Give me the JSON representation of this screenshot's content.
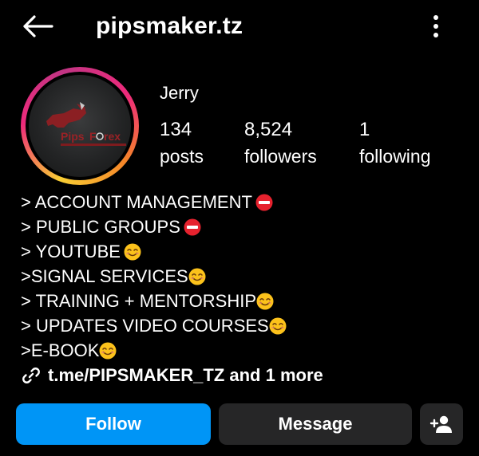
{
  "header": {
    "username": "pipsmaker.tz",
    "back_icon": "arrow-left-icon",
    "more_icon": "vertical-dots-icon"
  },
  "profile": {
    "display_name": "Jerry",
    "avatar": {
      "brand_text_1": "Pips",
      "brand_text_2": "F",
      "brand_text_3": "rex",
      "ring_colors": [
        "#f9ce34",
        "#ee2a7b",
        "#c13584",
        "#f58529"
      ]
    }
  },
  "stats": {
    "posts": {
      "value": "134",
      "label": "posts"
    },
    "followers": {
      "value": "8,524",
      "label": "followers"
    },
    "following": {
      "value": "1",
      "label": "following"
    }
  },
  "bio": {
    "lines": [
      {
        "text": "> ACCOUNT MANAGEMENT ",
        "emoji": "no-entry-emoji"
      },
      {
        "text": "> PUBLIC GROUPS ",
        "emoji": "no-entry-emoji"
      },
      {
        "text": "> YOUTUBE ",
        "emoji": "smiling-face-emoji"
      },
      {
        "text": ">SIGNAL SERVICES",
        "emoji": "smiling-face-emoji"
      },
      {
        "text": "> TRAINING + MENTORSHIP",
        "emoji": "smiling-face-emoji"
      },
      {
        "text": "> UPDATES VIDEO COURSES",
        "emoji": "smiling-face-emoji"
      },
      {
        "text": ">E-BOOK",
        "emoji": "smiling-face-emoji"
      }
    ],
    "link_text": "t.me/PIPSMAKER_TZ and 1 more"
  },
  "actions": {
    "follow_label": "Follow",
    "message_label": "Message",
    "add_user_icon": "add-person-icon"
  },
  "colors": {
    "background": "#000000",
    "follow_button": "#0095f6",
    "secondary_button": "#262627",
    "text": "#ffffff"
  }
}
